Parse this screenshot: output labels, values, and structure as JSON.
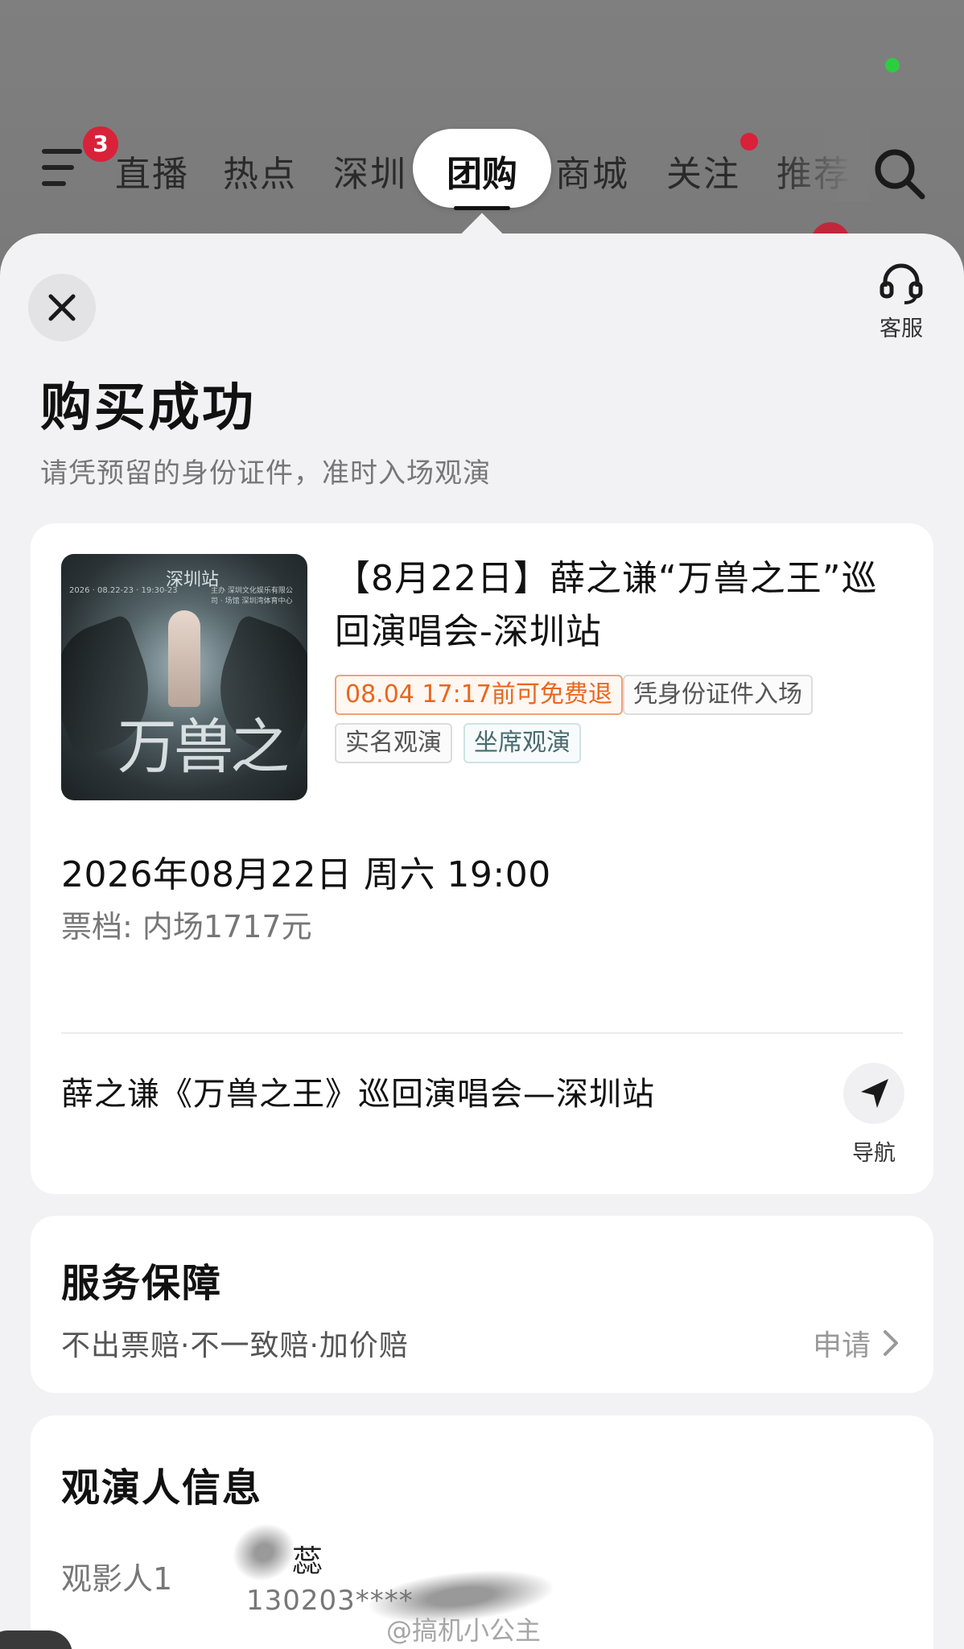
{
  "header": {
    "menu_badge": "3",
    "nav_tabs": [
      {
        "label": "直播"
      },
      {
        "label": "热点"
      },
      {
        "label": "深圳"
      },
      {
        "label": "团购",
        "active": true
      },
      {
        "label": "商城"
      },
      {
        "label": "关注",
        "has_dot": true
      },
      {
        "label": "推荐"
      }
    ],
    "icons": {
      "menu": "menu-icon",
      "search": "search-icon"
    }
  },
  "sheet": {
    "service_label": "客服",
    "title": "购买成功",
    "subtitle": "请凭预留的身份证件，准时入场观演"
  },
  "event": {
    "title": "【8月22日】薛之谦“万兽之王”巡回演唱会-深圳站",
    "tags": [
      {
        "text": "08.04 17:17前可免费退",
        "style": "orange"
      },
      {
        "text": "凭身份证件入场",
        "style": "gray"
      },
      {
        "text": "实名观演",
        "style": "gray"
      },
      {
        "text": "坐席观演",
        "style": "teal"
      }
    ],
    "poster": {
      "station": "深圳站",
      "title": "万兽之王",
      "date": "2026 · 08.22-23 · 19:30-23",
      "info": "主办 深圳文化娱乐有限公司 · 场馆 深圳湾体育中心"
    },
    "datetime": "2026年08月22日 周六 19:00",
    "ticket_tier": "票档: 内场1717元",
    "venue": "薛之谦《万兽之王》巡回演唱会—深圳站",
    "navigate_label": "导航"
  },
  "service_guarantee": {
    "title": "服务保障",
    "items": "不出票赔·不一致赔·加价赔",
    "apply_label": "申请"
  },
  "viewer": {
    "title": "观演人信息",
    "label": "观影人1",
    "name": "蕊",
    "id_masked": "130203****"
  },
  "watermark": "@搞机小公主",
  "colors": {
    "accent_orange": "#e8671e",
    "badge_red": "#d9213a",
    "background": "#f2f2f4",
    "overlay_gray": "#7d7d7d"
  }
}
